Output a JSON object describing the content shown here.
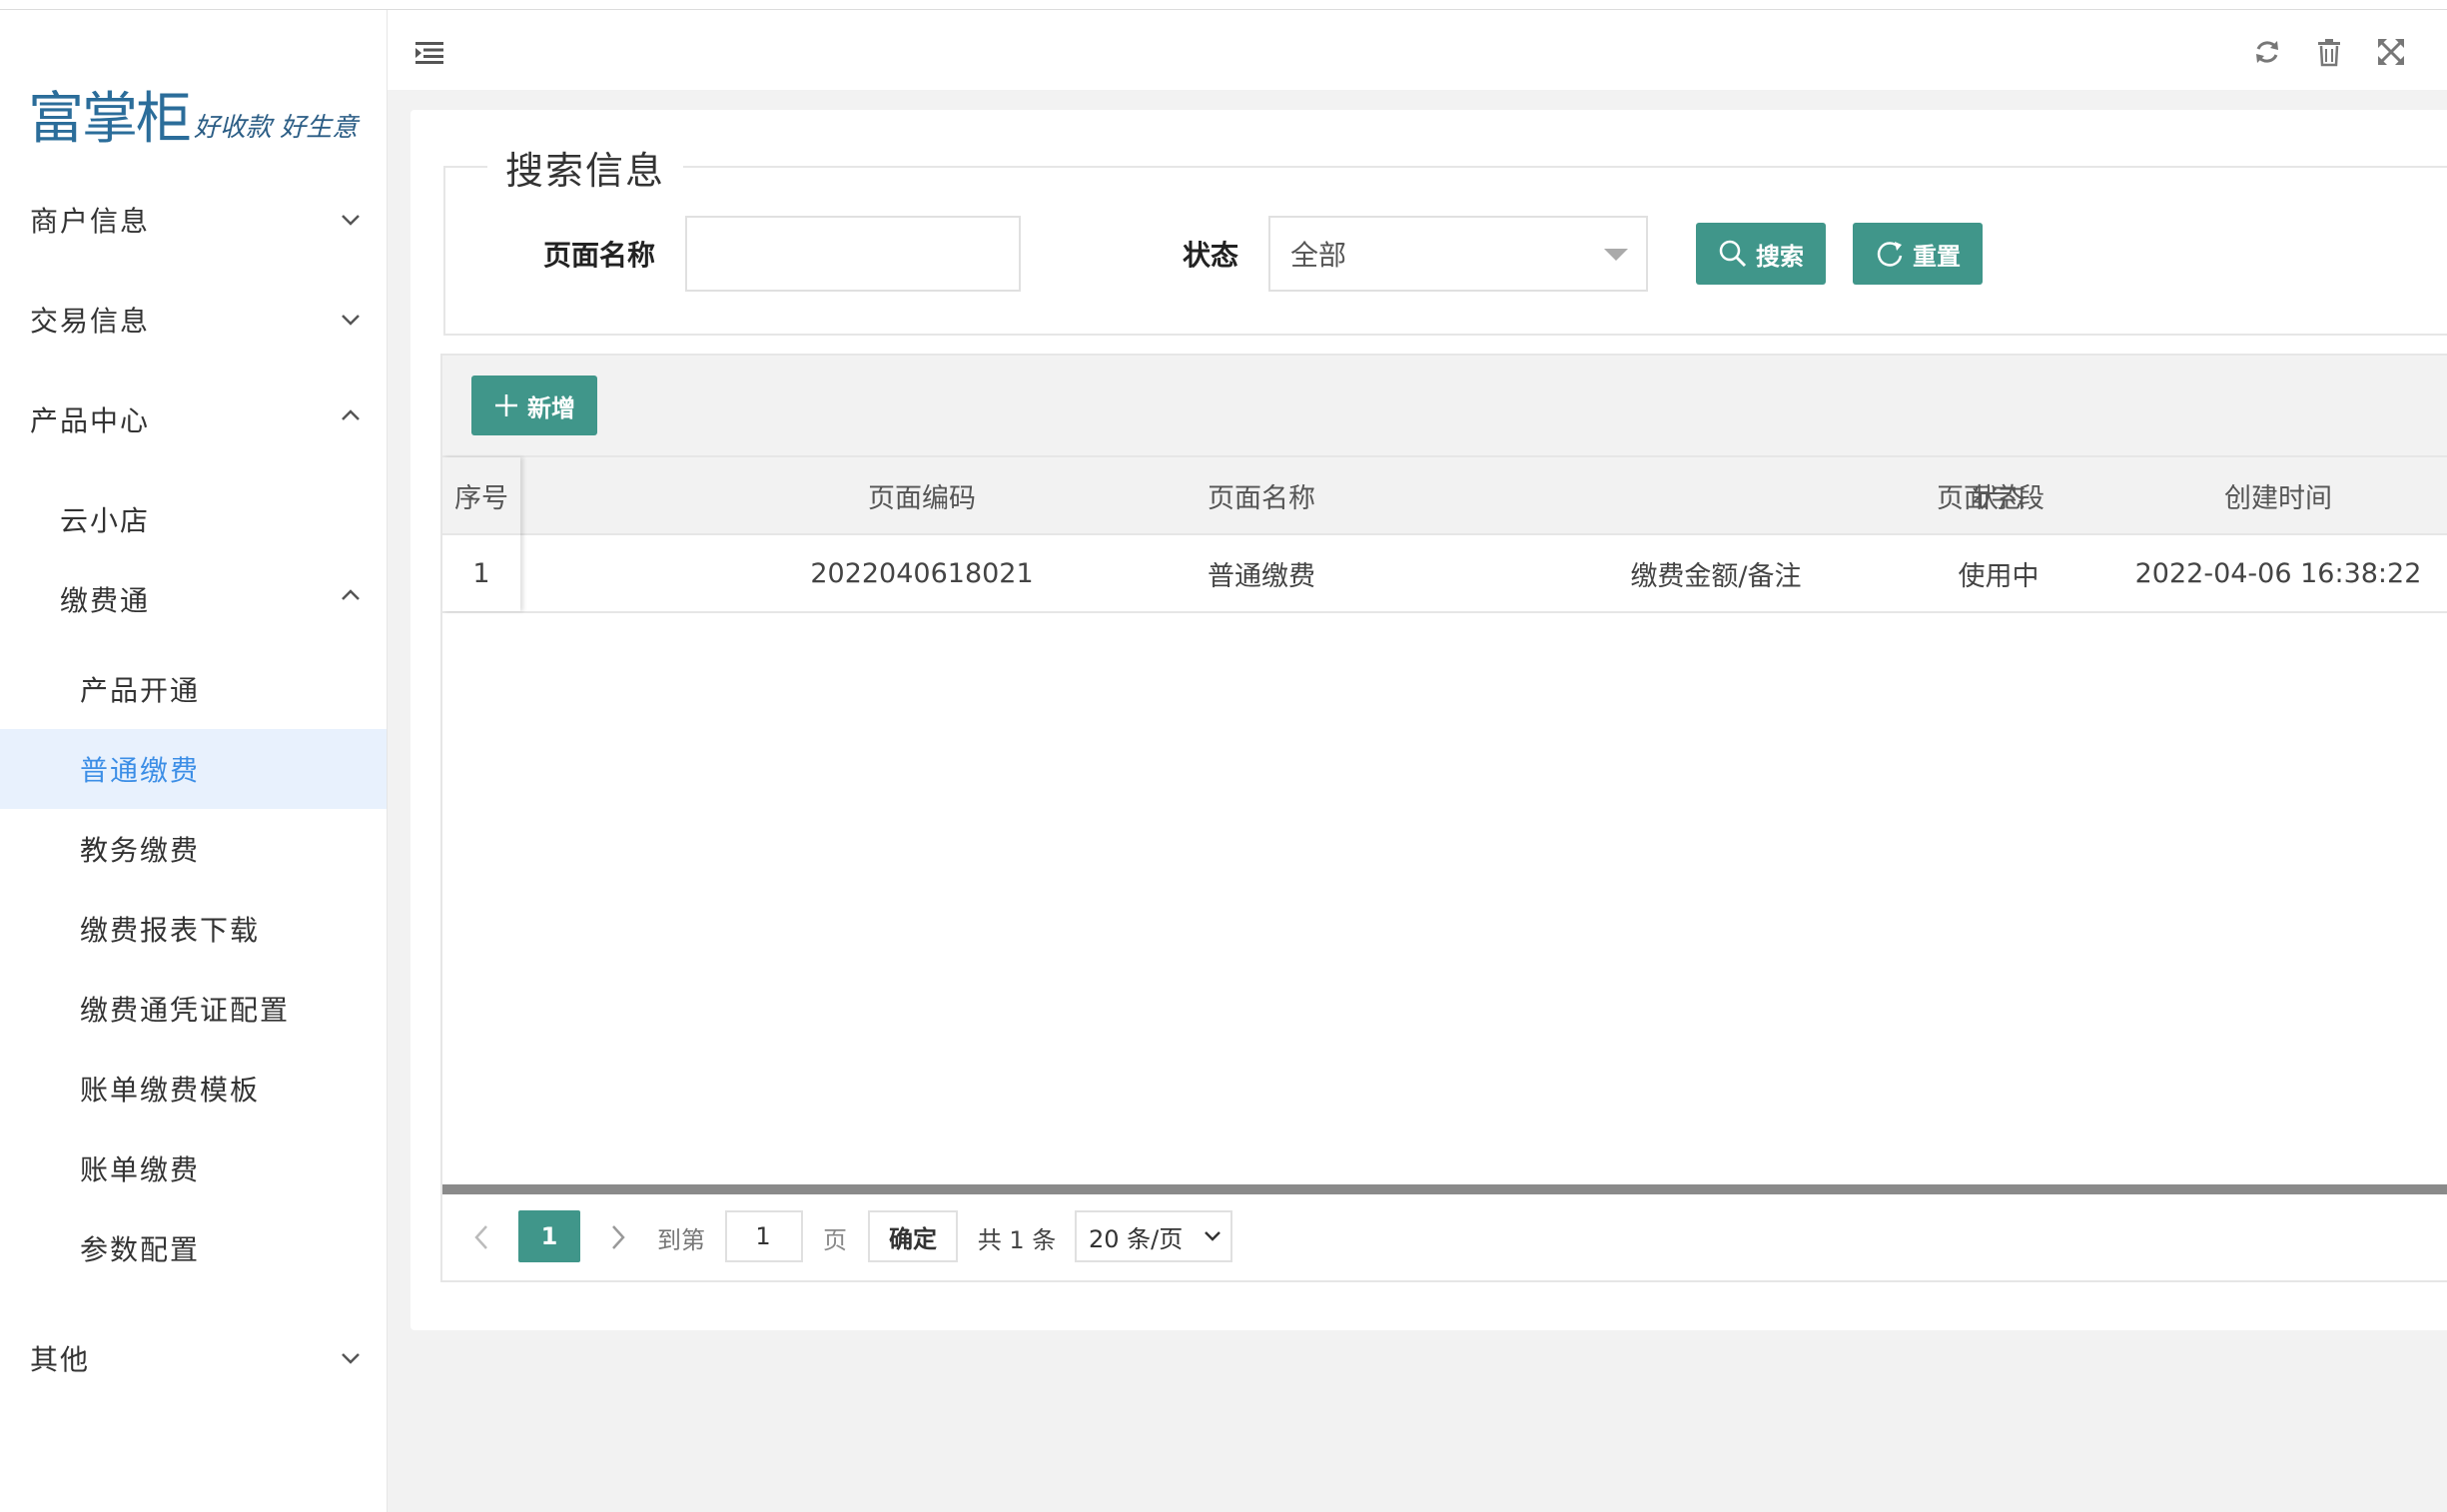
{
  "logo": {
    "main": "富掌柜",
    "slogan": "好收款 好生意"
  },
  "sidebar": {
    "items": [
      {
        "label": "商户信息",
        "expanded": false
      },
      {
        "label": "交易信息",
        "expanded": false
      },
      {
        "label": "产品中心",
        "expanded": true
      },
      {
        "label": "云小店"
      },
      {
        "label": "缴费通",
        "expanded": true
      },
      {
        "label": "产品开通"
      },
      {
        "label": "普通缴费",
        "active": true
      },
      {
        "label": "教务缴费"
      },
      {
        "label": "缴费报表下载"
      },
      {
        "label": "缴费通凭证配置"
      },
      {
        "label": "账单缴费模板"
      },
      {
        "label": "账单缴费"
      },
      {
        "label": "参数配置"
      },
      {
        "label": "其他",
        "expanded": false
      }
    ]
  },
  "header": {
    "icons": [
      "menu-collapse-icon",
      "refresh-icon",
      "trash-icon",
      "fullscreen-icon"
    ]
  },
  "search": {
    "legend": "搜索信息",
    "page_name_label": "页面名称",
    "page_name_value": "",
    "status_label": "状态",
    "status_value": "全部",
    "search_button": "搜索",
    "reset_button": "重置"
  },
  "toolbar": {
    "add_button": "新增"
  },
  "table": {
    "columns": [
      "序号",
      "页面编码",
      "页面名称",
      "页面字段",
      "状态",
      "创建时间"
    ],
    "rows": [
      [
        "1",
        "2022040618021",
        "普通缴费",
        "缴费金额/备注",
        "使用中",
        "2022-04-06 16:38:22"
      ]
    ]
  },
  "pagination": {
    "current_page": "1",
    "goto_label": "到第",
    "goto_value": "1",
    "page_unit": "页",
    "confirm": "确定",
    "total": "共 1 条",
    "page_size": "20 条/页"
  },
  "colors": {
    "accent": "#40968a",
    "active_bg": "#e8f1fd",
    "active_text": "#3c8ee6"
  }
}
